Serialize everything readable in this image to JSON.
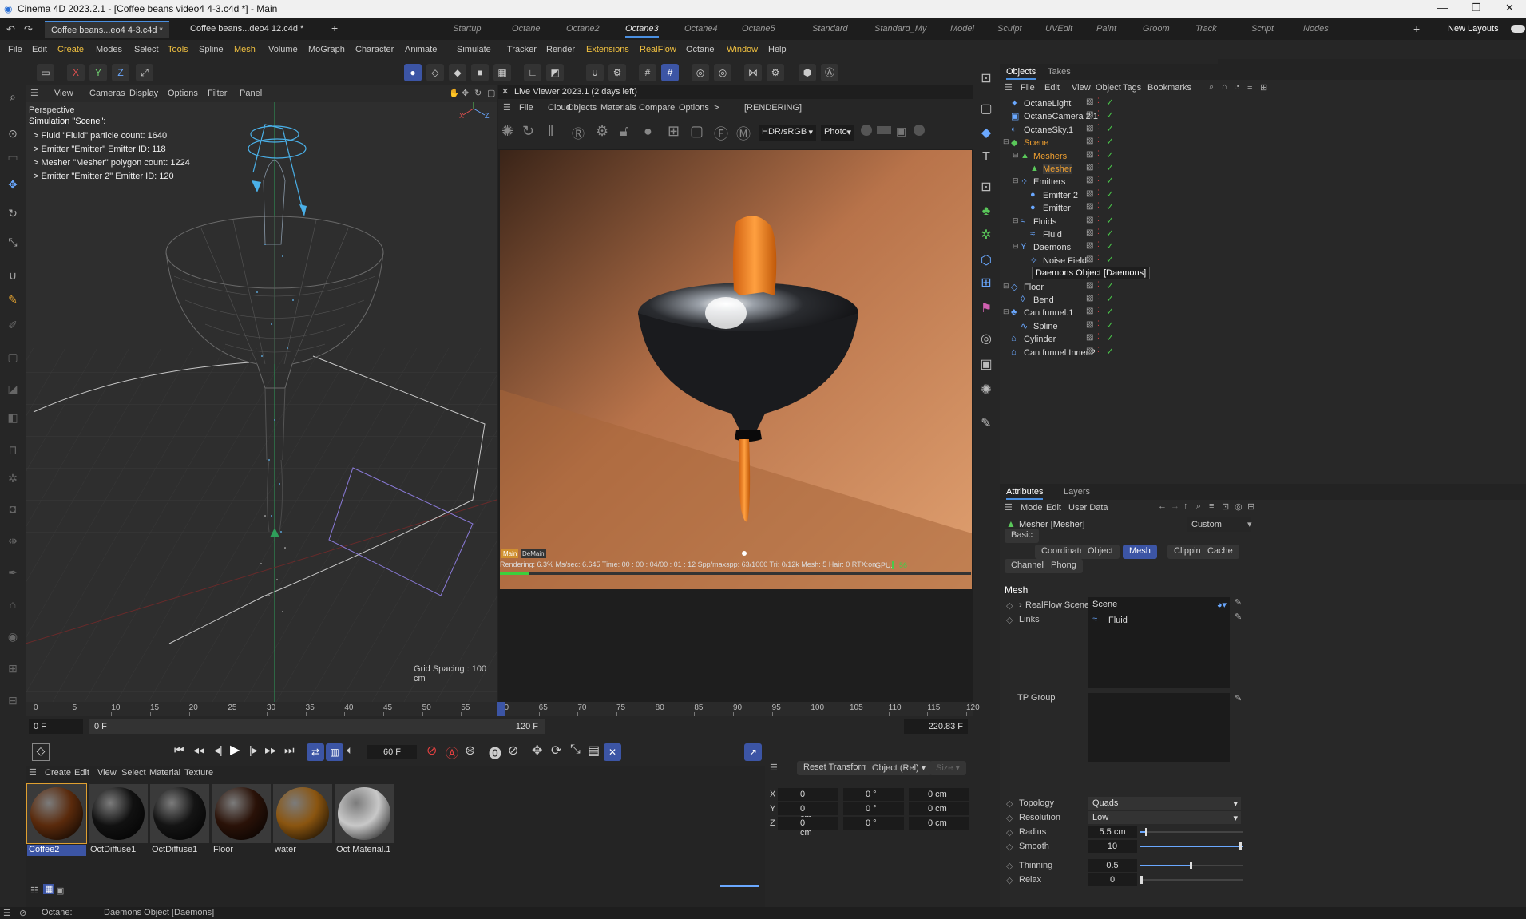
{
  "window": {
    "title": "Cinema 4D 2023.2.1 - [Coffee beans video4 4-3.c4d *] - Main",
    "min": "—",
    "max": "❐",
    "close": "✕"
  },
  "doc_tabs": [
    "Coffee beans...eo4 4-3.c4d *",
    "Coffee beans...deo4 12.c4d *"
  ],
  "layouts": [
    "Startup",
    "Octane",
    "Octane2",
    "Octane3",
    "Octane4",
    "Octane5",
    "Standard",
    "Standard_My",
    "Model",
    "Sculpt",
    "UVEdit",
    "Paint",
    "Groom",
    "Track",
    "Script",
    "Nodes"
  ],
  "active_layout": "Octane3",
  "new_layouts": "New Layouts",
  "menu": [
    "File",
    "Edit",
    "Create",
    "Modes",
    "Select",
    "Tools",
    "Spline",
    "Mesh",
    "Volume",
    "MoGraph",
    "Character",
    "Animate",
    "Simulate",
    "Tracker",
    "Render",
    "Extensions",
    "RealFlow",
    "Octane",
    "Window",
    "Help"
  ],
  "toolbar_axes": [
    "X",
    "Y",
    "Z"
  ],
  "viewport": {
    "menu": [
      "View",
      "Cameras",
      "Display",
      "Options",
      "Filter",
      "Panel"
    ],
    "name": "Perspective",
    "sim_title": "Simulation \"Scene\":",
    "sim_lines": [
      "> Fluid \"Fluid\" particle count: 1640",
      "> Emitter \"Emitter\" Emitter ID: 118",
      "> Mesher \"Mesher\" polygon count: 1224",
      "> Emitter \"Emitter 2\" Emitter ID: 120"
    ],
    "grid": "Grid Spacing : 100 cm",
    "axis_x": "X",
    "axis_y": "Y",
    "axis_z": "Z"
  },
  "live": {
    "title": "Live Viewer 2023.1 (2 days left)",
    "menu": [
      "File",
      "Cloud",
      "Objects",
      "Materials",
      "Compare",
      "Options",
      ">"
    ],
    "status": "[RENDERING]",
    "colorspace": "HDR/sRGB",
    "mode": "Photo",
    "tag_main": "Main",
    "tag_demain": "DeMain",
    "stats": "Rendering: 6.3%  Ms/sec: 6.645  Time: 00 : 00 : 04/00 : 01 : 12  Spp/maxspp: 63/1000  Tri: 0/12k  Mesh: 5  Hair: 0  RTX:on",
    "gpu_label": "GPU:",
    "gpu_value": "56",
    "progress": 0.063
  },
  "objects": {
    "tabs": [
      "Objects",
      "Takes"
    ],
    "menu": [
      "File",
      "Edit",
      "View",
      "Object",
      "Tags",
      "Bookmarks"
    ],
    "rows": [
      {
        "name": "OctaneLight",
        "indent": 0,
        "color": "#dddddd",
        "icon": "light-icon",
        "sym": "✦"
      },
      {
        "name": "OctaneCamera 2.1",
        "indent": 0,
        "color": "#dddddd",
        "icon": "camera-icon",
        "sym": "▣"
      },
      {
        "name": "OctaneSky.1",
        "indent": 0,
        "color": "#dddddd",
        "icon": "sky-icon",
        "sym": "◐"
      },
      {
        "name": "Scene",
        "indent": 0,
        "color": "#f0a030",
        "icon": "scene-icon",
        "sym": "◆"
      },
      {
        "name": "Meshers",
        "indent": 1,
        "color": "#f0a030",
        "icon": "meshers-icon",
        "sym": "▲"
      },
      {
        "name": "Mesher",
        "indent": 2,
        "color": "#f0a030",
        "icon": "mesher-icon",
        "sym": "▲"
      },
      {
        "name": "Emitters",
        "indent": 1,
        "color": "#dddddd",
        "icon": "emitters-icon",
        "sym": "⁘"
      },
      {
        "name": "Emitter 2",
        "indent": 2,
        "color": "#dddddd",
        "icon": "emitter-icon",
        "sym": "●"
      },
      {
        "name": "Emitter",
        "indent": 2,
        "color": "#dddddd",
        "icon": "emitter-icon",
        "sym": "●"
      },
      {
        "name": "Fluids",
        "indent": 1,
        "color": "#dddddd",
        "icon": "fluids-icon",
        "sym": "≈"
      },
      {
        "name": "Fluid",
        "indent": 2,
        "color": "#dddddd",
        "icon": "fluid-icon",
        "sym": "≈"
      },
      {
        "name": "Daemons",
        "indent": 1,
        "color": "#dddddd",
        "icon": "daemons-icon",
        "sym": "Y"
      },
      {
        "name": "Noise Field",
        "indent": 2,
        "color": "#dddddd",
        "icon": "noise-icon",
        "sym": "✧"
      },
      {
        "name": "Daemons Object [Daemons]",
        "indent": 2,
        "color": "#ffffff",
        "icon": "tooltip",
        "sym": ""
      },
      {
        "name": "Floor",
        "indent": 0,
        "color": "#dddddd",
        "icon": "floor-icon",
        "sym": "◇"
      },
      {
        "name": "Bend",
        "indent": 1,
        "color": "#dddddd",
        "icon": "bend-icon",
        "sym": "◊"
      },
      {
        "name": "Can funnel.1",
        "indent": 0,
        "color": "#dddddd",
        "icon": "lathe-icon",
        "sym": "♣"
      },
      {
        "name": "Spline",
        "indent": 1,
        "color": "#dddddd",
        "icon": "spline-icon",
        "sym": "∿"
      },
      {
        "name": "Cylinder",
        "indent": 0,
        "color": "#dddddd",
        "icon": "cylinder-icon",
        "sym": "⌂"
      },
      {
        "name": "Can funnel Inner.2",
        "indent": 0,
        "color": "#dddddd",
        "icon": "lathe-icon",
        "sym": "⌂"
      }
    ]
  },
  "attributes": {
    "tabs": [
      "Attributes",
      "Layers"
    ],
    "menu": [
      "Mode",
      "Edit",
      "User Data"
    ],
    "object": "Mesher [Mesher]",
    "preset": "Custom",
    "prop_tabs": [
      "Basic",
      "Coordinates",
      "Object",
      "Mesh",
      "Clipping",
      "Cache",
      "Channels",
      "Phong"
    ],
    "active_tab": "Mesh",
    "section": "Mesh",
    "realflow_label": "RealFlow Scene",
    "realflow_value": "Scene",
    "links_label": "Links",
    "links_value": "Fluid",
    "tp_label": "TP Group",
    "params": [
      {
        "label": "Topology",
        "value": "Quads",
        "type": "select"
      },
      {
        "label": "Resolution",
        "value": "Low",
        "type": "select"
      },
      {
        "label": "Radius",
        "value": "5.5 cm",
        "type": "slider",
        "level": 0.05
      },
      {
        "label": "Smooth",
        "value": "10",
        "type": "slider",
        "level": 1.0
      },
      {
        "label": "Thinning",
        "value": "0.5",
        "type": "slider",
        "level": 0.5
      },
      {
        "label": "Relax",
        "value": "0",
        "type": "slider",
        "level": 0.0
      }
    ]
  },
  "timeline": {
    "ticks": [
      "0",
      "5",
      "10",
      "15",
      "20",
      "25",
      "30",
      "35",
      "40",
      "45",
      "50",
      "55",
      "60",
      "65",
      "70",
      "75",
      "80",
      "85",
      "90",
      "95",
      "100",
      "105",
      "110",
      "115",
      "120"
    ],
    "current_frame": 60,
    "start": "0 F",
    "start2": "0 F",
    "end": "120 F",
    "frame_end": "220.83 F",
    "fps": "60 F"
  },
  "coords": {
    "reset": "Reset Transform",
    "mode": "Object (Rel)",
    "size": "Size",
    "rows": [
      {
        "axis": "X",
        "pos": "0 cm",
        "rot": "0 °",
        "scale": "0 cm"
      },
      {
        "axis": "Y",
        "pos": "0 cm",
        "rot": "0 °",
        "scale": "0 cm"
      },
      {
        "axis": "Z",
        "pos": "0 cm",
        "rot": "0 °",
        "scale": "0 cm"
      }
    ]
  },
  "materials": {
    "menu": [
      "Create",
      "Edit",
      "View",
      "Select",
      "Material",
      "Texture"
    ],
    "items": [
      {
        "name": "Coffee2",
        "color": "#5a2a0c",
        "selected": true
      },
      {
        "name": "OctDiffuse1",
        "color": "#111111",
        "selected": false
      },
      {
        "name": "OctDiffuse1",
        "color": "#141414",
        "selected": false
      },
      {
        "name": "Floor",
        "color": "#2a1208",
        "selected": false
      },
      {
        "name": "water",
        "color": "#8a5510",
        "selected": false
      },
      {
        "name": "Oct Material.1",
        "color": "#c8c8c8",
        "selected": false
      }
    ]
  },
  "status": {
    "label": "Octane:",
    "message": "Daemons Object [Daemons]"
  }
}
